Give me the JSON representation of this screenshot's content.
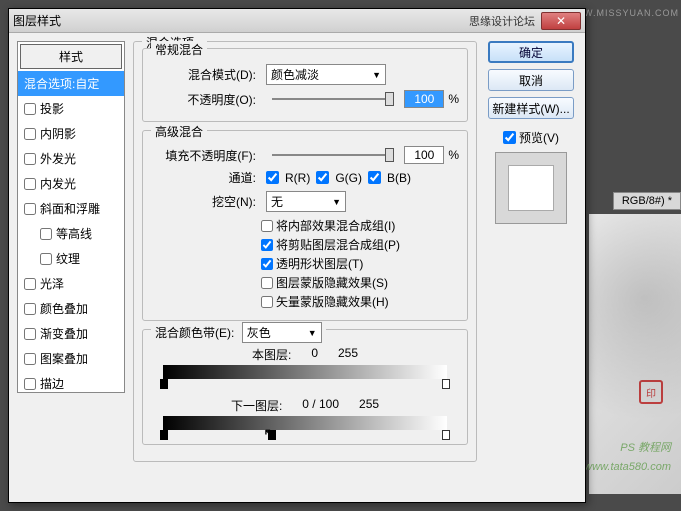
{
  "titlebar": {
    "title": "图层样式",
    "right_text": "思缘设计论坛",
    "watermark": "WWW.MISSYUAN.COM"
  },
  "styles": {
    "header": "样式",
    "items": [
      {
        "kind": "selected",
        "label": "混合选项:自定"
      },
      {
        "kind": "chk",
        "label": "投影",
        "checked": false
      },
      {
        "kind": "chk",
        "label": "内阴影",
        "checked": false
      },
      {
        "kind": "chk",
        "label": "外发光",
        "checked": false
      },
      {
        "kind": "chk",
        "label": "内发光",
        "checked": false
      },
      {
        "kind": "chk",
        "label": "斜面和浮雕",
        "checked": false
      },
      {
        "kind": "chk-indent",
        "label": "等高线",
        "checked": false
      },
      {
        "kind": "chk-indent",
        "label": "纹理",
        "checked": false
      },
      {
        "kind": "chk",
        "label": "光泽",
        "checked": false
      },
      {
        "kind": "chk",
        "label": "颜色叠加",
        "checked": false
      },
      {
        "kind": "chk",
        "label": "渐变叠加",
        "checked": false
      },
      {
        "kind": "chk",
        "label": "图案叠加",
        "checked": false
      },
      {
        "kind": "chk",
        "label": "描边",
        "checked": false
      }
    ]
  },
  "blend_options": {
    "title": "混合选项",
    "general": {
      "title": "常规混合",
      "mode_label": "混合模式(D):",
      "mode_value": "颜色减淡",
      "opacity_label": "不透明度(O):",
      "opacity_value": "100",
      "pct": "%"
    },
    "advanced": {
      "title": "高级混合",
      "fill_label": "填充不透明度(F):",
      "fill_value": "100",
      "pct": "%",
      "channels_label": "通道:",
      "ch_r": "R(R)",
      "ch_g": "G(G)",
      "ch_b": "B(B)",
      "knockout_label": "挖空(N):",
      "knockout_value": "无",
      "opts": [
        {
          "label": "将内部效果混合成组(I)",
          "checked": false
        },
        {
          "label": "将剪贴图层混合成组(P)",
          "checked": true
        },
        {
          "label": "透明形状图层(T)",
          "checked": true
        },
        {
          "label": "图层蒙版隐藏效果(S)",
          "checked": false
        },
        {
          "label": "矢量蒙版隐藏效果(H)",
          "checked": false
        }
      ]
    },
    "blend_if": {
      "title": "混合颜色带(E):",
      "value": "灰色",
      "this_label": "本图层:",
      "this_lo": "0",
      "this_hi": "255",
      "under_label": "下一图层:",
      "under_lo": "0",
      "under_mid": "100",
      "under_hi": "255"
    }
  },
  "buttons": {
    "ok": "确定",
    "cancel": "取消",
    "new_style": "新建样式(W)...",
    "preview": "预览(V)"
  },
  "doc_tab": "RGB/8#) *",
  "watermarks": {
    "line1": "PS 教程网",
    "line2": "www.tata580.com"
  }
}
